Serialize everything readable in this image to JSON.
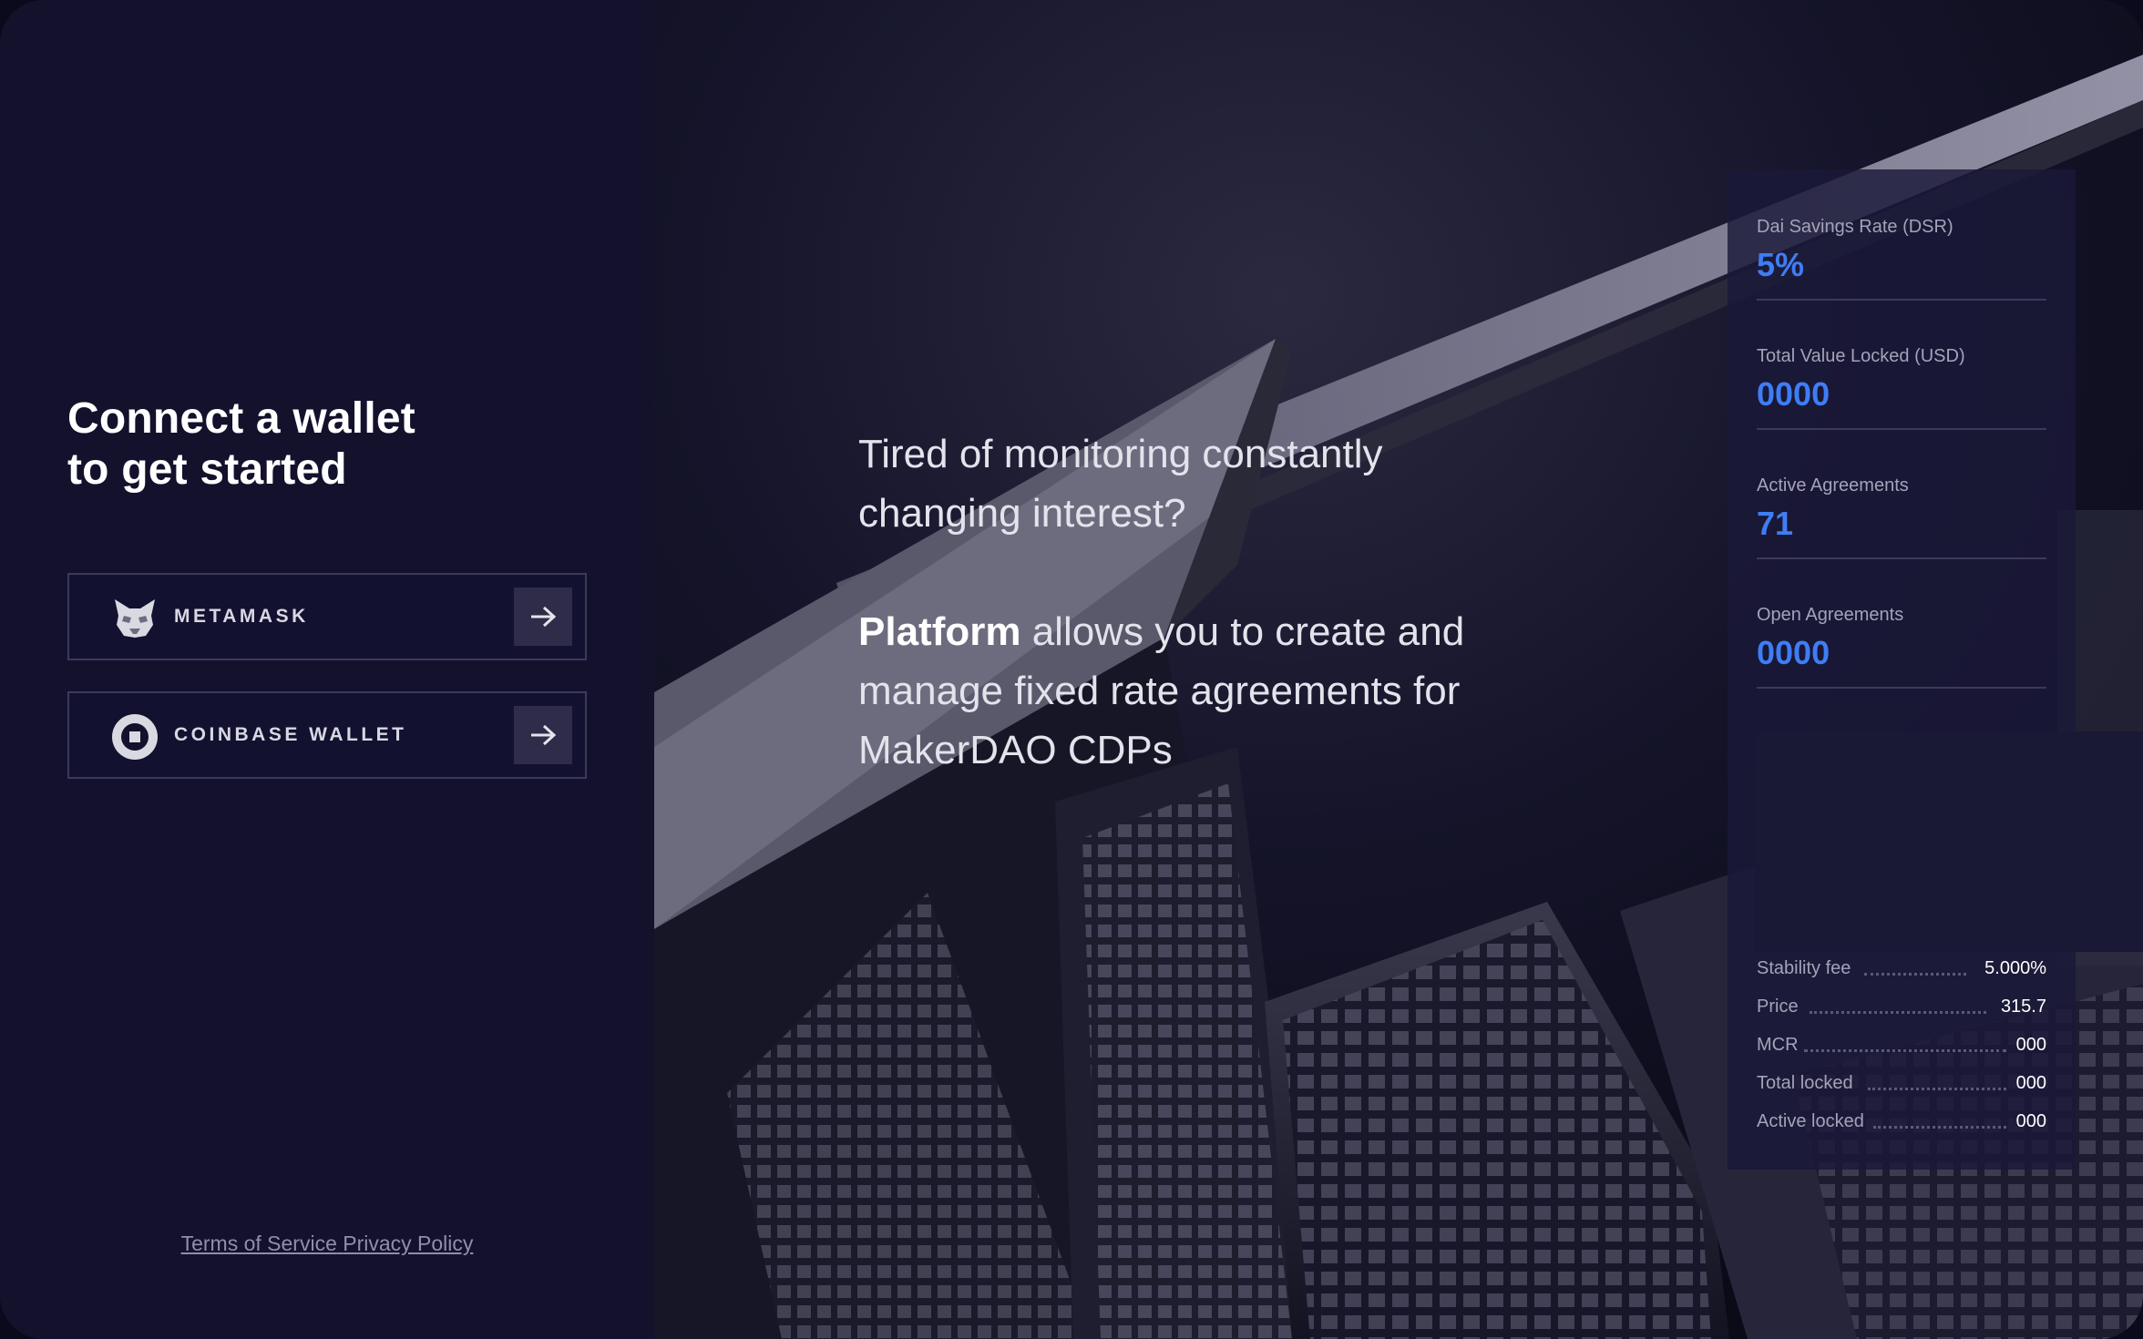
{
  "left_panel": {
    "heading_line1": "Connect a wallet",
    "heading_line2": "to get started",
    "wallets": [
      {
        "label": "METAMASK",
        "icon": "metamask-fox-icon"
      },
      {
        "label": "COINBASE WALLET",
        "icon": "coinbase-icon"
      }
    ],
    "terms_link": "Terms of Service",
    "privacy_link": "Privacy Policy"
  },
  "hero": {
    "question_line1": "Tired of monitoring constantly",
    "question_line2": "changing interest?",
    "brand": "Platform",
    "desc_line1": " allows you to create and",
    "desc_line2": "manage fixed rate agreements for",
    "desc_line3": "MakerDAO CDPs"
  },
  "stats": [
    {
      "label": "Dai Savings Rate (DSR)",
      "value": "5%"
    },
    {
      "label": "Total Value Locked (USD)",
      "value": "0000"
    },
    {
      "label": "Active Agreements",
      "value": "71"
    },
    {
      "label": "Open Agreements",
      "value": "0000"
    }
  ],
  "details": [
    {
      "label": "Stability fee",
      "value": "5.000%"
    },
    {
      "label": "Price",
      "value": "315.7"
    },
    {
      "label": "MCR",
      "value": "000"
    },
    {
      "label": "Total locked",
      "value": "000"
    },
    {
      "label": "Active locked",
      "value": "000"
    }
  ],
  "colors": {
    "accent": "#3f7df5",
    "panel_bg": "#13112c"
  }
}
